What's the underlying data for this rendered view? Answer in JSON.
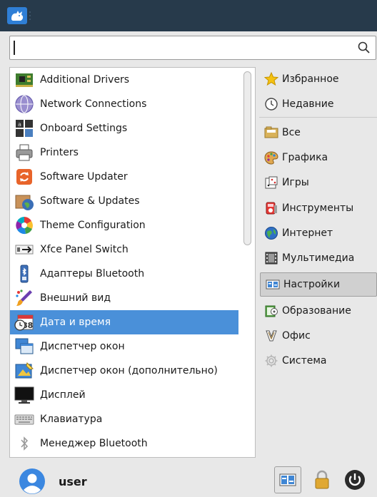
{
  "search": {
    "value": "",
    "placeholder": ""
  },
  "apps": [
    {
      "label": "Additional Drivers",
      "icon": "circuit-board-icon",
      "selected": false
    },
    {
      "label": "Network Connections",
      "icon": "network-globe-icon",
      "selected": false
    },
    {
      "label": "Onboard Settings",
      "icon": "keyboard-grid-icon",
      "selected": false
    },
    {
      "label": "Printers",
      "icon": "printer-icon",
      "selected": false
    },
    {
      "label": "Software Updater",
      "icon": "update-arrows-icon",
      "selected": false
    },
    {
      "label": "Software & Updates",
      "icon": "box-globe-icon",
      "selected": false
    },
    {
      "label": "Theme Configuration",
      "icon": "color-wheel-icon",
      "selected": false
    },
    {
      "label": "Xfce Panel Switch",
      "icon": "panel-switch-icon",
      "selected": false
    },
    {
      "label": "Адаптеры Bluetooth",
      "icon": "bluetooth-adapter-icon",
      "selected": false
    },
    {
      "label": "Внешний вид",
      "icon": "paint-brush-icon",
      "selected": false
    },
    {
      "label": "Дата и время",
      "icon": "calendar-clock-icon",
      "selected": true
    },
    {
      "label": "Диспетчер окон",
      "icon": "windows-icon",
      "selected": false
    },
    {
      "label": "Диспетчер окон (дополнительно)",
      "icon": "windows-tweaks-icon",
      "selected": false
    },
    {
      "label": "Дисплей",
      "icon": "monitor-icon",
      "selected": false
    },
    {
      "label": "Клавиатура",
      "icon": "keyboard-icon",
      "selected": false
    },
    {
      "label": "Менеджер Bluetooth",
      "icon": "bluetooth-icon",
      "selected": false
    }
  ],
  "categories": [
    {
      "label": "Избранное",
      "icon": "star-icon",
      "selected": false
    },
    {
      "label": "Недавние",
      "icon": "clock-history-icon",
      "selected": false
    },
    {
      "label": "Все",
      "icon": "folder-icon",
      "selected": false
    },
    {
      "label": "Графика",
      "icon": "palette-icon",
      "selected": false
    },
    {
      "label": "Игры",
      "icon": "games-icon",
      "selected": false
    },
    {
      "label": "Инструменты",
      "icon": "tools-icon",
      "selected": false
    },
    {
      "label": "Интернет",
      "icon": "globe-icon",
      "selected": false
    },
    {
      "label": "Мультимедиа",
      "icon": "film-icon",
      "selected": false
    },
    {
      "label": "Настройки",
      "icon": "settings-panel-icon",
      "selected": true
    },
    {
      "label": "Образование",
      "icon": "education-icon",
      "selected": false
    },
    {
      "label": "Офис",
      "icon": "office-icon",
      "selected": false
    },
    {
      "label": "Система",
      "icon": "gear-icon",
      "selected": false
    }
  ],
  "user": {
    "name": "user"
  },
  "colors": {
    "topbar": "#273a4b",
    "selection": "#4a90d9"
  }
}
